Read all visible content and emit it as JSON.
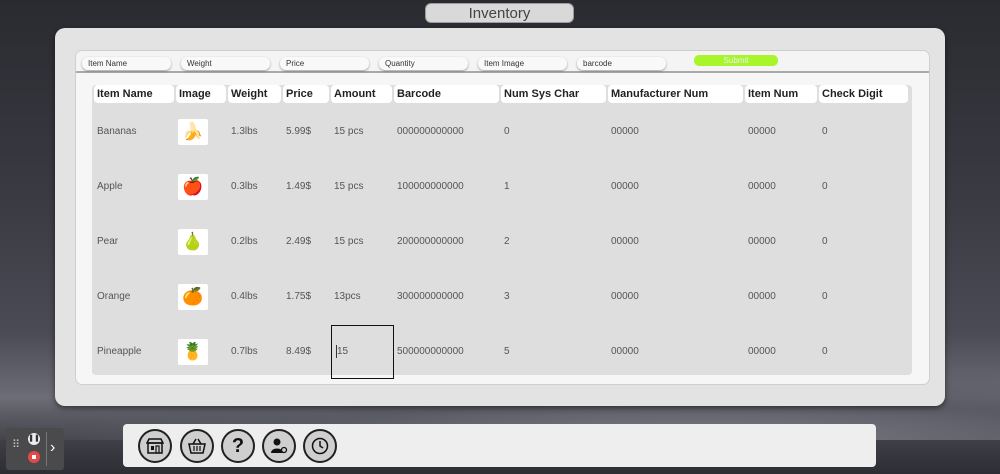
{
  "header": {
    "title": "Inventory"
  },
  "form": {
    "fields": [
      {
        "placeholder": "Item Name"
      },
      {
        "placeholder": "Weight"
      },
      {
        "placeholder": "Price"
      },
      {
        "placeholder": "Quantity"
      },
      {
        "placeholder": "Item Image"
      },
      {
        "placeholder": "barcode"
      }
    ],
    "submit_label": "Submit"
  },
  "table": {
    "columns": [
      "Item Name",
      "Image",
      "Weight",
      "Price",
      "Amount",
      "Barcode",
      "Num Sys Char",
      "Manufacturer Num",
      "Item Num",
      "Check Digit"
    ],
    "rows": [
      {
        "name": "Bananas",
        "image_icon": "banana-icon",
        "weight": "1.3lbs",
        "price": "5.99$",
        "amount": "15 pcs",
        "barcode": "000000000000",
        "num_sys_char": "0",
        "manufacturer_num": "00000",
        "item_num": "00000",
        "check_digit": "0"
      },
      {
        "name": "Apple",
        "image_icon": "apple-icon",
        "weight": "0.3lbs",
        "price": "1.49$",
        "amount": "15 pcs",
        "barcode": "100000000000",
        "num_sys_char": "1",
        "manufacturer_num": "00000",
        "item_num": "00000",
        "check_digit": "0"
      },
      {
        "name": "Pear",
        "image_icon": "pear-icon",
        "weight": "0.2lbs",
        "price": "2.49$",
        "amount": "15 pcs",
        "barcode": "200000000000",
        "num_sys_char": "2",
        "manufacturer_num": "00000",
        "item_num": "00000",
        "check_digit": "0"
      },
      {
        "name": "Orange",
        "image_icon": "orange-icon",
        "weight": "0.4lbs",
        "price": "1.75$",
        "amount": "13pcs",
        "barcode": "300000000000",
        "num_sys_char": "3",
        "manufacturer_num": "00000",
        "item_num": "00000",
        "check_digit": "0"
      },
      {
        "name": "Pineapple",
        "image_icon": "pineapple-icon",
        "weight": "0.7lbs",
        "price": "8.49$",
        "amount": "15",
        "barcode": "500000000000",
        "num_sys_char": "5",
        "manufacturer_num": "00000",
        "item_num": "00000",
        "check_digit": "0"
      }
    ]
  },
  "dock": {
    "buttons": [
      "store-icon",
      "basket-icon",
      "help-icon",
      "user-settings-icon",
      "clock-icon"
    ]
  },
  "playback": {
    "controls": [
      "pause-icon",
      "stop-icon",
      "chevron-right-icon"
    ]
  },
  "colors": {
    "submit": "#a8f52b",
    "panel": "#e3e3e3"
  }
}
